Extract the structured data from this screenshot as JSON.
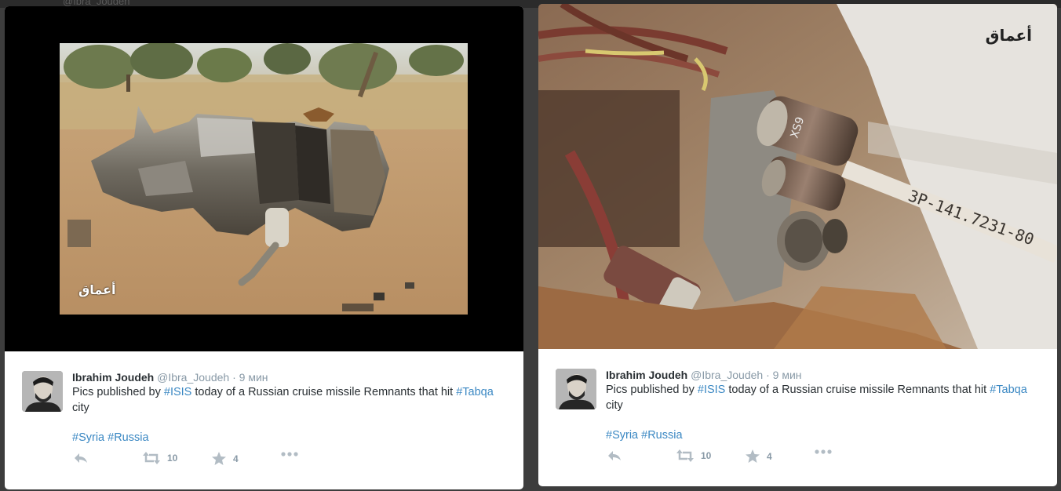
{
  "background": {
    "ghost_handle": "@Ibra_Joudeh"
  },
  "colors": {
    "hashtag": "#3b88c3",
    "meta": "#8899a6",
    "text": "#292f33",
    "icon": "#b2bcc4"
  },
  "tweets": [
    {
      "author": {
        "full_name": "Ibrahim Joudeh",
        "username": "@Ibra_Joudeh",
        "time": "9 мин",
        "avatar_icon": "avatar-photo"
      },
      "text_before": "Pics published by ",
      "hashtag_isis": "#ISIS",
      "text_middle": " today of a Russian cruise missile Remnants that hit ",
      "hashtag_tabqa": "#Tabqa",
      "text_after": " city",
      "hashtag_syria": "#Syria",
      "hashtag_russia": "#Russia",
      "media": {
        "watermark": "أعماق",
        "subject": "missile-wreckage-in-desert"
      },
      "actions": {
        "reply_icon": "reply-icon",
        "retweet_icon": "retweet-icon",
        "retweet_count": "10",
        "favorite_icon": "star-icon",
        "favorite_count": "4",
        "more_icon": "more-dots-icon"
      }
    },
    {
      "author": {
        "full_name": "Ibrahim Joudeh",
        "username": "@Ibra_Joudeh",
        "time": "9 мин",
        "avatar_icon": "avatar-photo"
      },
      "text_before": "Pics published by ",
      "hashtag_isis": "#ISIS",
      "text_middle": " today of a Russian cruise missile Remnants that hit ",
      "hashtag_tabqa": "#Tabqa",
      "text_after": " city",
      "hashtag_syria": "#Syria",
      "hashtag_russia": "#Russia",
      "media": {
        "watermark": "أعماق",
        "subject": "missile-wiring-connectors-closeup",
        "part_label": "3Р-141.7231-80",
        "connector_label": "XS9"
      },
      "actions": {
        "reply_icon": "reply-icon",
        "retweet_icon": "retweet-icon",
        "retweet_count": "10",
        "favorite_icon": "star-icon",
        "favorite_count": "4",
        "more_icon": "more-dots-icon"
      }
    }
  ]
}
